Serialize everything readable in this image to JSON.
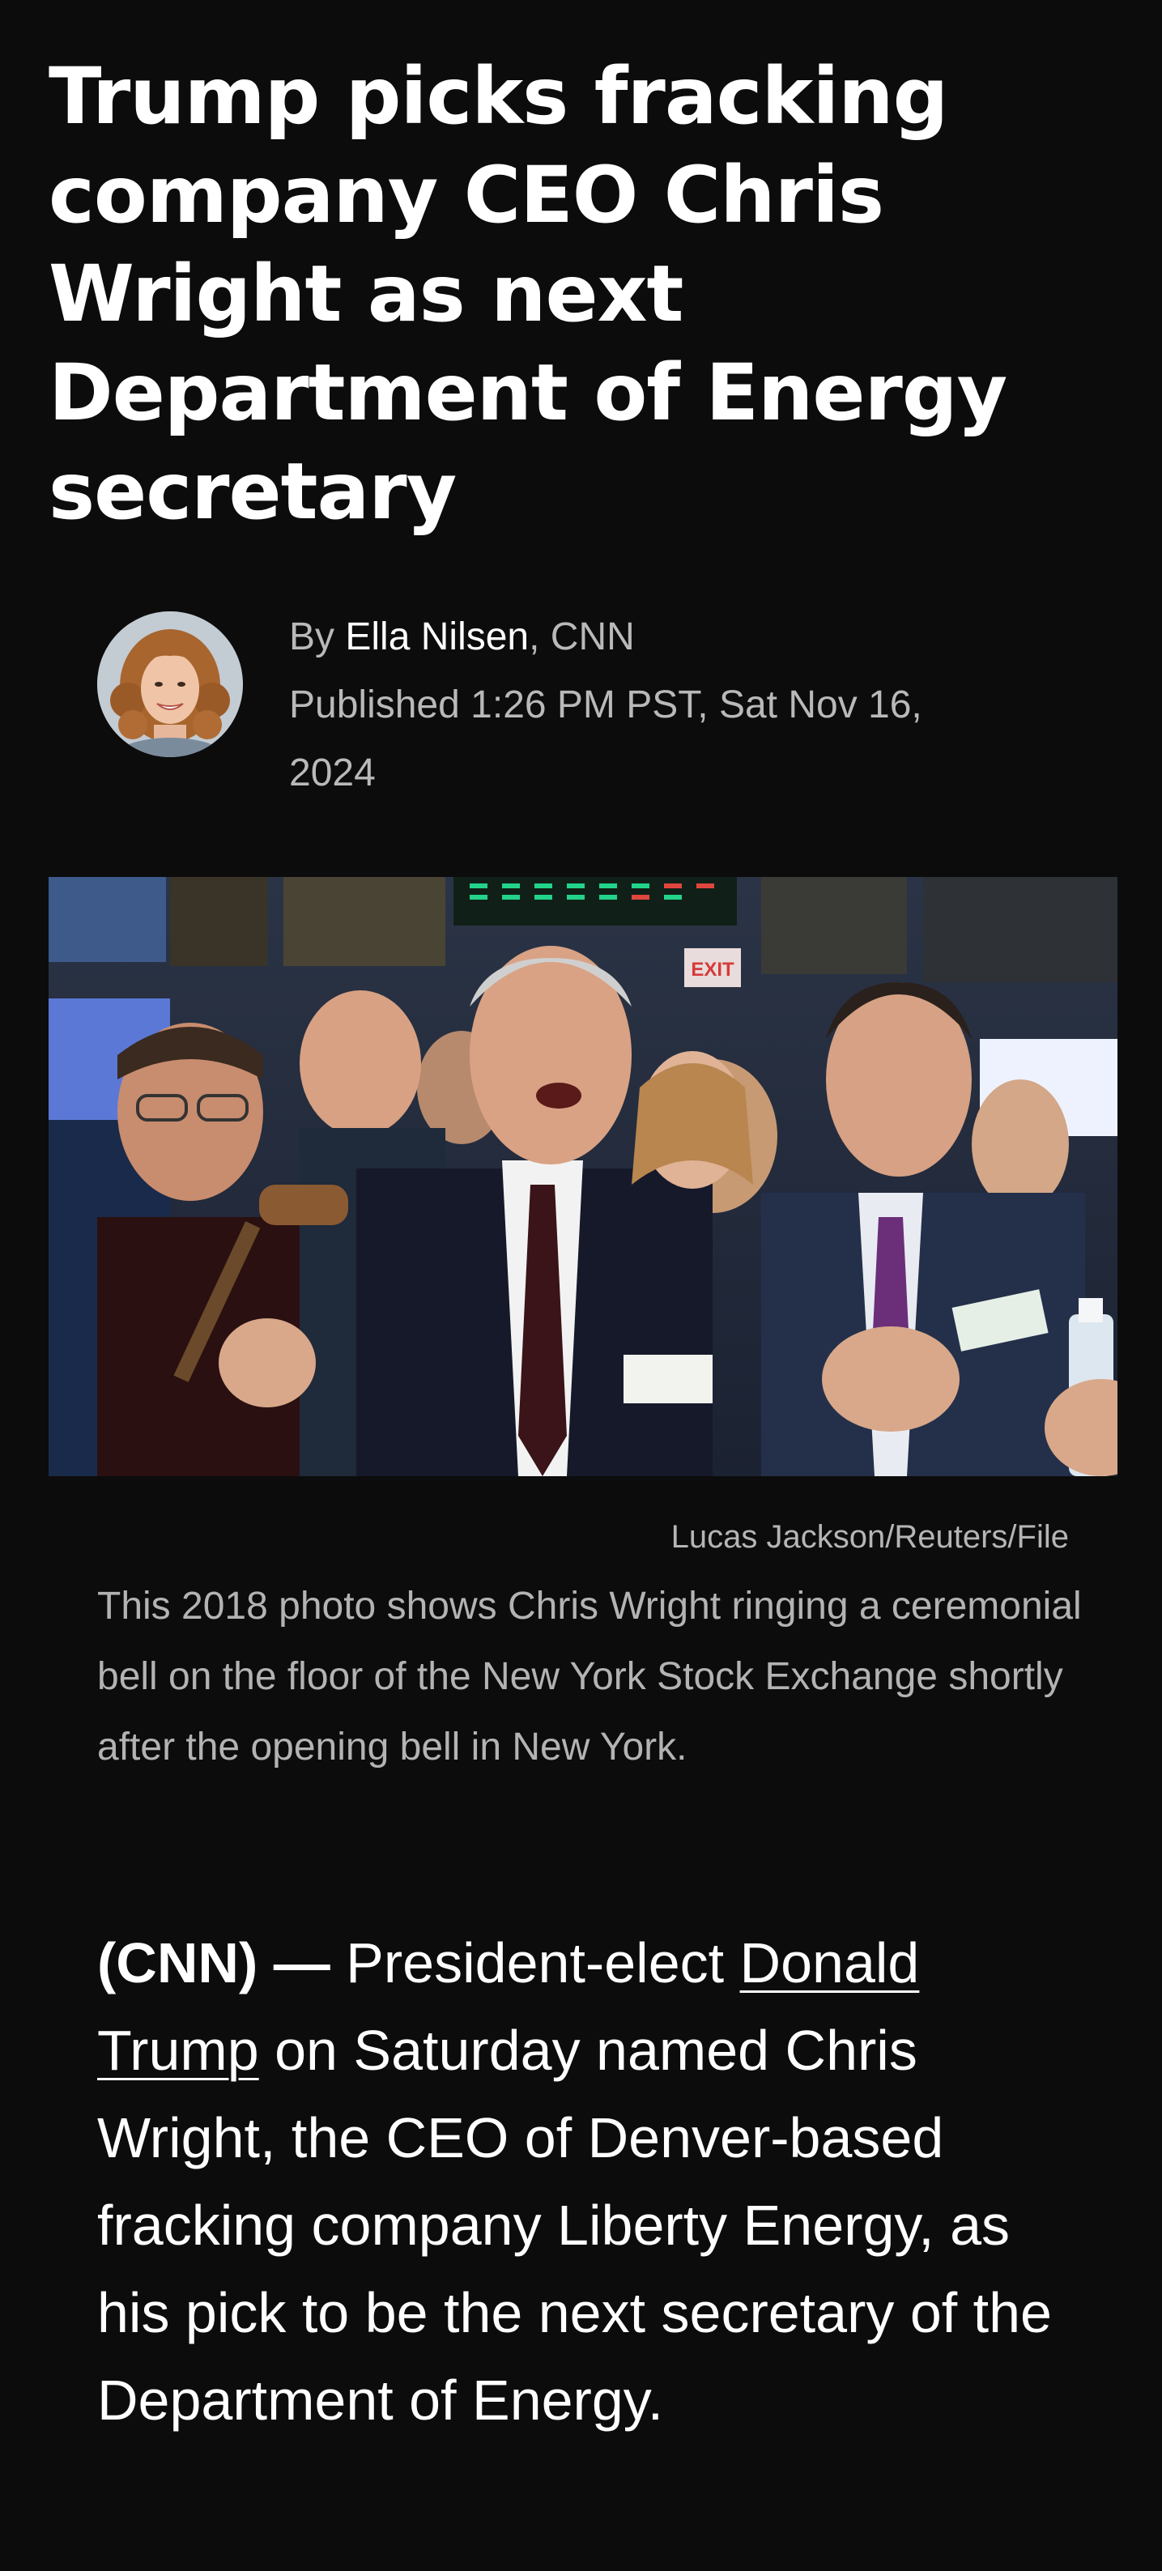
{
  "article": {
    "headline": "Trump picks fracking company CEO Chris Wright as next Department of Energy secretary",
    "byline": {
      "prefix": "By ",
      "author": "Ella Nilsen",
      "outlet": ", CNN",
      "published": "Published 1:26 PM PST, Sat Nov 16, 2024"
    },
    "image": {
      "credit": "Lucas Jackson/Reuters/File",
      "caption": "This 2018 photo shows Chris Wright ringing a ceremonial bell on the floor of the New York Stock Exchange shortly after the opening bell in New York.",
      "exit_sign": "EXIT"
    },
    "body": {
      "dateline": "(CNN) —",
      "text_before_link": " President-elect ",
      "link_text": "Donald Trump",
      "text_after_link": " on Saturday named Chris Wright, the CEO of Denver-based fracking company Liberty Energy, as his pick to be the next secretary of the Department of Energy."
    }
  },
  "colors": {
    "background": "#0c0c0c",
    "text_primary": "#ffffff",
    "text_secondary": "#b3b3b3"
  }
}
